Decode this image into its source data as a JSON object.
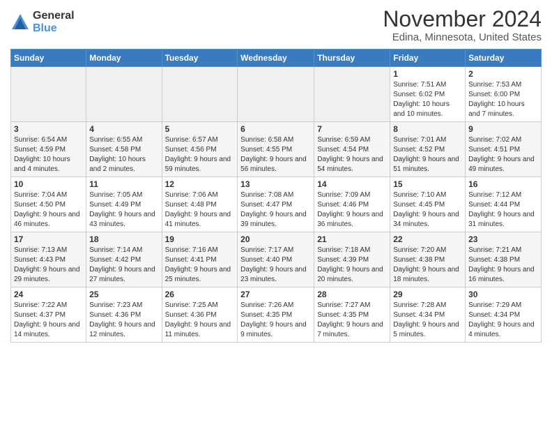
{
  "logo": {
    "general": "General",
    "blue": "Blue"
  },
  "title": "November 2024",
  "location": "Edina, Minnesota, United States",
  "days_of_week": [
    "Sunday",
    "Monday",
    "Tuesday",
    "Wednesday",
    "Thursday",
    "Friday",
    "Saturday"
  ],
  "weeks": [
    [
      {
        "day": "",
        "info": ""
      },
      {
        "day": "",
        "info": ""
      },
      {
        "day": "",
        "info": ""
      },
      {
        "day": "",
        "info": ""
      },
      {
        "day": "",
        "info": ""
      },
      {
        "day": "1",
        "info": "Sunrise: 7:51 AM\nSunset: 6:02 PM\nDaylight: 10 hours and 10 minutes."
      },
      {
        "day": "2",
        "info": "Sunrise: 7:53 AM\nSunset: 6:00 PM\nDaylight: 10 hours and 7 minutes."
      }
    ],
    [
      {
        "day": "3",
        "info": "Sunrise: 6:54 AM\nSunset: 4:59 PM\nDaylight: 10 hours and 4 minutes."
      },
      {
        "day": "4",
        "info": "Sunrise: 6:55 AM\nSunset: 4:58 PM\nDaylight: 10 hours and 2 minutes."
      },
      {
        "day": "5",
        "info": "Sunrise: 6:57 AM\nSunset: 4:56 PM\nDaylight: 9 hours and 59 minutes."
      },
      {
        "day": "6",
        "info": "Sunrise: 6:58 AM\nSunset: 4:55 PM\nDaylight: 9 hours and 56 minutes."
      },
      {
        "day": "7",
        "info": "Sunrise: 6:59 AM\nSunset: 4:54 PM\nDaylight: 9 hours and 54 minutes."
      },
      {
        "day": "8",
        "info": "Sunrise: 7:01 AM\nSunset: 4:52 PM\nDaylight: 9 hours and 51 minutes."
      },
      {
        "day": "9",
        "info": "Sunrise: 7:02 AM\nSunset: 4:51 PM\nDaylight: 9 hours and 49 minutes."
      }
    ],
    [
      {
        "day": "10",
        "info": "Sunrise: 7:04 AM\nSunset: 4:50 PM\nDaylight: 9 hours and 46 minutes."
      },
      {
        "day": "11",
        "info": "Sunrise: 7:05 AM\nSunset: 4:49 PM\nDaylight: 9 hours and 43 minutes."
      },
      {
        "day": "12",
        "info": "Sunrise: 7:06 AM\nSunset: 4:48 PM\nDaylight: 9 hours and 41 minutes."
      },
      {
        "day": "13",
        "info": "Sunrise: 7:08 AM\nSunset: 4:47 PM\nDaylight: 9 hours and 39 minutes."
      },
      {
        "day": "14",
        "info": "Sunrise: 7:09 AM\nSunset: 4:46 PM\nDaylight: 9 hours and 36 minutes."
      },
      {
        "day": "15",
        "info": "Sunrise: 7:10 AM\nSunset: 4:45 PM\nDaylight: 9 hours and 34 minutes."
      },
      {
        "day": "16",
        "info": "Sunrise: 7:12 AM\nSunset: 4:44 PM\nDaylight: 9 hours and 31 minutes."
      }
    ],
    [
      {
        "day": "17",
        "info": "Sunrise: 7:13 AM\nSunset: 4:43 PM\nDaylight: 9 hours and 29 minutes."
      },
      {
        "day": "18",
        "info": "Sunrise: 7:14 AM\nSunset: 4:42 PM\nDaylight: 9 hours and 27 minutes."
      },
      {
        "day": "19",
        "info": "Sunrise: 7:16 AM\nSunset: 4:41 PM\nDaylight: 9 hours and 25 minutes."
      },
      {
        "day": "20",
        "info": "Sunrise: 7:17 AM\nSunset: 4:40 PM\nDaylight: 9 hours and 23 minutes."
      },
      {
        "day": "21",
        "info": "Sunrise: 7:18 AM\nSunset: 4:39 PM\nDaylight: 9 hours and 20 minutes."
      },
      {
        "day": "22",
        "info": "Sunrise: 7:20 AM\nSunset: 4:38 PM\nDaylight: 9 hours and 18 minutes."
      },
      {
        "day": "23",
        "info": "Sunrise: 7:21 AM\nSunset: 4:38 PM\nDaylight: 9 hours and 16 minutes."
      }
    ],
    [
      {
        "day": "24",
        "info": "Sunrise: 7:22 AM\nSunset: 4:37 PM\nDaylight: 9 hours and 14 minutes."
      },
      {
        "day": "25",
        "info": "Sunrise: 7:23 AM\nSunset: 4:36 PM\nDaylight: 9 hours and 12 minutes."
      },
      {
        "day": "26",
        "info": "Sunrise: 7:25 AM\nSunset: 4:36 PM\nDaylight: 9 hours and 11 minutes."
      },
      {
        "day": "27",
        "info": "Sunrise: 7:26 AM\nSunset: 4:35 PM\nDaylight: 9 hours and 9 minutes."
      },
      {
        "day": "28",
        "info": "Sunrise: 7:27 AM\nSunset: 4:35 PM\nDaylight: 9 hours and 7 minutes."
      },
      {
        "day": "29",
        "info": "Sunrise: 7:28 AM\nSunset: 4:34 PM\nDaylight: 9 hours and 5 minutes."
      },
      {
        "day": "30",
        "info": "Sunrise: 7:29 AM\nSunset: 4:34 PM\nDaylight: 9 hours and 4 minutes."
      }
    ]
  ]
}
